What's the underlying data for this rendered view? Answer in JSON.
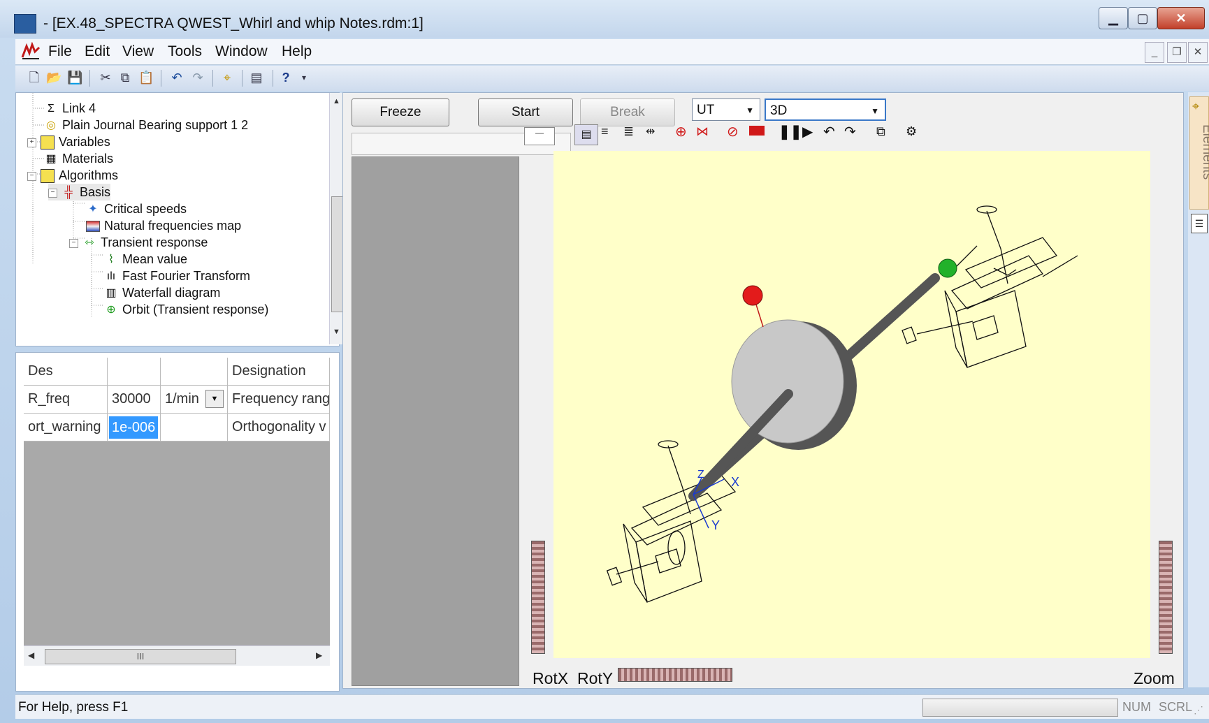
{
  "window": {
    "title": "- [EX.48_SPECTRA QWEST_Whirl and whip Notes.rdm:1]"
  },
  "menu": [
    "File",
    "Edit",
    "View",
    "Tools",
    "Window",
    "Help"
  ],
  "tree": [
    {
      "label": "Link 4",
      "icon": "link-icon"
    },
    {
      "label": "Plain Journal Bearing support 1 2",
      "icon": "bearing-icon"
    },
    {
      "label": "Variables",
      "icon": "variables-icon"
    },
    {
      "label": "Materials",
      "icon": "materials-icon"
    },
    {
      "label": "Algorithms",
      "icon": "algorithms-icon"
    },
    {
      "label": "Basis",
      "icon": "basis-icon"
    },
    {
      "label": "Critical speeds",
      "icon": "critical-speeds-icon"
    },
    {
      "label": "Natural frequencies map",
      "icon": "frequency-map-icon"
    },
    {
      "label": "Transient response",
      "icon": "transient-icon"
    },
    {
      "label": "Mean value",
      "icon": "mean-value-icon"
    },
    {
      "label": "Fast Fourier Transform",
      "icon": "fft-icon"
    },
    {
      "label": "Waterfall diagram",
      "icon": "waterfall-icon"
    },
    {
      "label": "Orbit (Transient response)",
      "icon": "orbit-icon"
    }
  ],
  "props": {
    "header": [
      "Des",
      "",
      "",
      "Designation"
    ],
    "rows": [
      [
        "R_freq",
        "30000",
        "1/min",
        "Frequency rang"
      ],
      [
        "ort_warning",
        "1e-006",
        "",
        "Orthogonality v"
      ]
    ],
    "hscroll_label": "III"
  },
  "view": {
    "buttons": {
      "freeze": "Freeze",
      "start": "Start",
      "break": "Break"
    },
    "combo_ut": "UT",
    "combo_3d": "3D",
    "labels": {
      "rotx": "RotX",
      "roty": "RotY",
      "zoom": "Zoom"
    },
    "axes": {
      "x": "X",
      "y": "Y",
      "z": "Z"
    }
  },
  "status": {
    "text": "For Help, press F1",
    "num": "NUM",
    "scrl": "SCRL"
  },
  "sidebar": {
    "elements": "Elements"
  },
  "colors": {
    "viewport_bg": "#ffffc9",
    "red_marker": "#e31b1b",
    "green_marker": "#22b12a"
  }
}
